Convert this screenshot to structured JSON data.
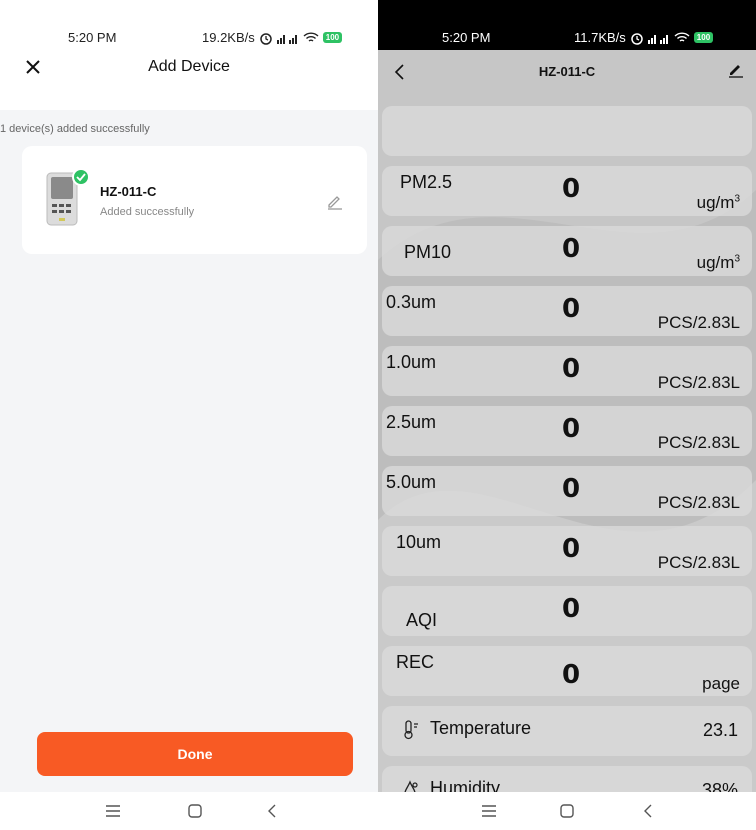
{
  "left": {
    "status": {
      "time": "5:20 PM",
      "speed": "19.2KB/s",
      "battery": "100"
    },
    "header": {
      "title": "Add Device"
    },
    "count_text": "1 device(s) added successfully",
    "device": {
      "name": "HZ-011-C",
      "status": "Added successfully"
    },
    "done_label": "Done"
  },
  "right": {
    "status": {
      "time": "5:20 PM",
      "speed": "11.7KB/s",
      "battery": "100"
    },
    "header": {
      "title": "HZ-011-C"
    },
    "sup3": "3",
    "readings": [
      {
        "label": "PM2.5",
        "value": "0",
        "unit": "ug/m"
      },
      {
        "label": "PM10",
        "value": "0",
        "unit": "ug/m"
      },
      {
        "label": "0.3um",
        "value": "0",
        "unit": "PCS/2.83L"
      },
      {
        "label": "1.0um",
        "value": "0",
        "unit": "PCS/2.83L"
      },
      {
        "label": "2.5um",
        "value": "0",
        "unit": "PCS/2.83L"
      },
      {
        "label": "5.0um",
        "value": "0",
        "unit": "PCS/2.83L"
      },
      {
        "label": "10um",
        "value": "0",
        "unit": "PCS/2.83L"
      },
      {
        "label": "AQI",
        "value": "0",
        "unit": ""
      },
      {
        "label": "REC",
        "value": "0",
        "unit": "page"
      }
    ],
    "temperature": {
      "label": "Temperature",
      "value": "23.1"
    },
    "humidity": {
      "label": "Humidity",
      "value": "38%"
    }
  },
  "colors": {
    "accent": "#f85a24",
    "success": "#2ec264"
  },
  "icons": [
    "close-icon",
    "edit-icon",
    "check-icon",
    "back-icon",
    "thermometer-icon",
    "droplet-icon",
    "menu-icon",
    "home-icon"
  ]
}
